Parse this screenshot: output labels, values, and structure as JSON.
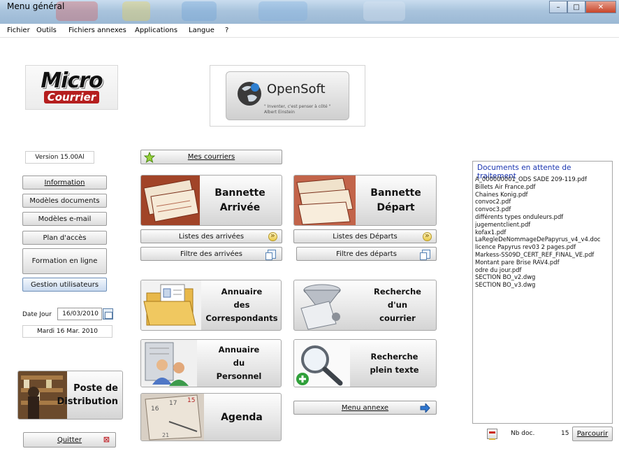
{
  "window": {
    "title": "Menu général",
    "controls": [
      "minimize",
      "maximize",
      "close"
    ]
  },
  "menubar": {
    "items": [
      "Fichier",
      "Outils",
      "Fichiers annexes",
      "Applications",
      "Langue",
      "?"
    ]
  },
  "logos": {
    "micro": "Micro",
    "courrier": "Courrier",
    "opensoft_name": "OpenSoft",
    "opensoft_quote": "\" Inventer, c'est penser à côté \"",
    "opensoft_author": "Albert Einstein"
  },
  "version": "Version 15.00Al",
  "left_buttons": {
    "information": "Information",
    "modeles_documents": "Modèles documents",
    "modeles_email": "Modèles e-mail",
    "plan_acces": "Plan d'accès",
    "formation": "Formation en ligne",
    "gestion": "Gestion utilisateurs"
  },
  "date": {
    "label": "Date Jour",
    "value": "16/03/2010",
    "day_text": "Mardi 16 Mar. 2010"
  },
  "poste": {
    "line1": "Poste de",
    "line2": "Distribution"
  },
  "quit_button": "Quitter",
  "main": {
    "mes_courriers": "Mes courriers",
    "bannette_arrivee": {
      "line1": "Bannette",
      "line2": "Arrivée"
    },
    "bannette_depart": {
      "line1": "Bannette",
      "line2": "Départ"
    },
    "listes_arrivees": "Listes des arrivées",
    "listes_departs": "Listes des Départs",
    "filtre_arrivees": "Filtre des arrivées",
    "filtre_departs": "Filtre des départs",
    "annuaire_corresp": {
      "line1": "Annuaire",
      "line2": "des",
      "line3": "Correspondants"
    },
    "recherche_courrier": {
      "line1": "Recherche",
      "line2": "d'un",
      "line3": "courrier"
    },
    "annuaire_personnel": {
      "line1": "Annuaire",
      "line2": "du",
      "line3": "Personnel"
    },
    "recherche_texte": {
      "line1": "Recherche",
      "line2": "plein texte"
    },
    "agenda": "Agenda",
    "menu_annexe": "Menu annexe"
  },
  "documents_panel": {
    "title": "Documents en attente de traitement",
    "items": [
      "A_000000001_ODS SADE 209-119.pdf",
      "Billets Air France.pdf",
      "Chaines Konig.pdf",
      "convoc2.pdf",
      "convoc3.pdf",
      "différents types onduleurs.pdf",
      "jugementclient.pdf",
      "kofax1.pdf",
      "LaRegleDeNommageDePapyrus_v4_v4.doc",
      "licence Papyrus rev03  2 pages.pdf",
      "Markess-SS09D_CERT_REF_FINAL_VE.pdf",
      "Montant pare Brise RAV4.pdf",
      "odre du jour.pdf",
      "SECTION BO_v2.dwg",
      "SECTION BO_v3.dwg"
    ],
    "nb_label": "Nb doc.",
    "nb_value": "15",
    "browse_button": "Parcourir"
  },
  "colors": {
    "panel_title": "#1a35b0",
    "titlebar": "#a9c4dd",
    "courrier_red": "#b51e1e"
  },
  "icons": [
    "star-icon",
    "arrow-right-icon",
    "copy-icon",
    "blue-arrow-icon",
    "calendar-icon",
    "close-x-icon",
    "document-icon"
  ]
}
